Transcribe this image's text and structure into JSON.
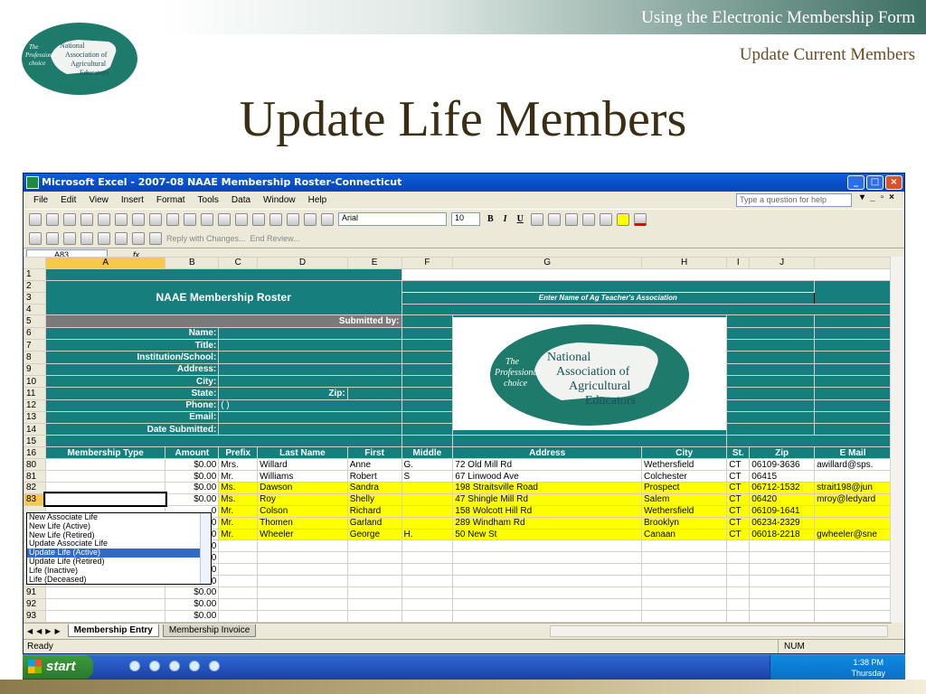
{
  "slide": {
    "header": "Using the Electronic Membership Form",
    "subheader": "Update Current Members",
    "title": "Update Life Members",
    "logo": {
      "line1": "The",
      "line2": "Professional",
      "line3": "choice",
      "n": "National",
      "a": "Association of",
      "g": "Agricultural",
      "e": "Educators"
    }
  },
  "excel": {
    "title": "Microsoft Excel - 2007-08 NAAE Membership Roster-Connecticut",
    "menu": [
      "File",
      "Edit",
      "View",
      "Insert",
      "Format",
      "Tools",
      "Data",
      "Window",
      "Help"
    ],
    "help_placeholder": "Type a question for help",
    "font_name": "Arial",
    "font_size": "10",
    "review_text": "Reply with Changes...",
    "end_review": "End Review...",
    "name_box": "A83",
    "fx": "fx",
    "columns": [
      "A",
      "B",
      "C",
      "D",
      "E",
      "F",
      "G",
      "H",
      "I",
      "J"
    ],
    "roster_title": "NAAE Membership Roster",
    "assoc_prompt": "Enter Name of Ag Teacher's Association",
    "submitted_by": "Submitted by:",
    "fields": [
      "Name:",
      "Title:",
      "Institution/School:",
      "Address:",
      "City:",
      "State:",
      "Phone:",
      "Email:",
      "Date Submitted:"
    ],
    "zip_label": "Zip:",
    "phone_value": "(      )",
    "headers": [
      "Membership Type",
      "Amount",
      "Prefix",
      "Last Name",
      "First",
      "Middle",
      "Address",
      "City",
      "St.",
      "Zip",
      "E Mail"
    ],
    "rows": [
      {
        "n": "80",
        "amt": "$0.00",
        "prefix": "Mrs.",
        "last": "Willard",
        "first": "Anne",
        "middle": "G.",
        "addr": "72 Old Mill Rd",
        "city": "Wethersfield",
        "st": "CT",
        "zip": "06109-3636",
        "email": "awillard@sps."
      },
      {
        "n": "81",
        "amt": "$0.00",
        "prefix": "Mr.",
        "last": "Williams",
        "first": "Robert",
        "middle": "S",
        "addr": "67 Linwood Ave",
        "city": "Colchester",
        "st": "CT",
        "zip": "06415",
        "email": ""
      },
      {
        "n": "82",
        "amt": "$0.00",
        "prefix": "Ms.",
        "last": "Dawson",
        "first": "Sandra",
        "middle": "",
        "addr": "198 Straitsville Road",
        "city": "Prospect",
        "st": "CT",
        "zip": "06712-1532",
        "email": "strait198@jun"
      },
      {
        "n": "83",
        "amt": "$0.00",
        "prefix": "Ms.",
        "last": "Roy",
        "first": "Shelly",
        "middle": "",
        "addr": "47 Shingle Mill Rd",
        "city": "Salem",
        "st": "CT",
        "zip": "06420",
        "email": "mroy@ledyard"
      },
      {
        "n": "",
        "amt": "0",
        "prefix": "Mr.",
        "last": "Colson",
        "first": "Richard",
        "middle": "",
        "addr": "158 Wolcott Hill Rd",
        "city": "Wethersfield",
        "st": "CT",
        "zip": "06109-1641",
        "email": ""
      },
      {
        "n": "",
        "amt": "0",
        "prefix": "Mr.",
        "last": "Thomen",
        "first": "Garland",
        "middle": "",
        "addr": "289 Windham Rd",
        "city": "Brooklyn",
        "st": "CT",
        "zip": "06234-2329",
        "email": ""
      },
      {
        "n": "",
        "amt": "0",
        "prefix": "Mr.",
        "last": "Wheeler",
        "first": "George",
        "middle": "H.",
        "addr": "50 New St",
        "city": "Canaan",
        "st": "CT",
        "zip": "06018-2218",
        "email": "gwheeler@sne"
      },
      {
        "n": "",
        "amt": "0",
        "prefix": "",
        "last": "",
        "first": "",
        "middle": "",
        "addr": "",
        "city": "",
        "st": "",
        "zip": "",
        "email": ""
      },
      {
        "n": "",
        "amt": "0",
        "prefix": "",
        "last": "",
        "first": "",
        "middle": "",
        "addr": "",
        "city": "",
        "st": "",
        "zip": "",
        "email": ""
      },
      {
        "n": "",
        "amt": "0",
        "prefix": "",
        "last": "",
        "first": "",
        "middle": "",
        "addr": "",
        "city": "",
        "st": "",
        "zip": "",
        "email": ""
      },
      {
        "n": "90",
        "amt": "$0.00",
        "prefix": "",
        "last": "",
        "first": "",
        "middle": "",
        "addr": "",
        "city": "",
        "st": "",
        "zip": "",
        "email": ""
      },
      {
        "n": "91",
        "amt": "$0.00",
        "prefix": "",
        "last": "",
        "first": "",
        "middle": "",
        "addr": "",
        "city": "",
        "st": "",
        "zip": "",
        "email": ""
      },
      {
        "n": "92",
        "amt": "$0.00",
        "prefix": "",
        "last": "",
        "first": "",
        "middle": "",
        "addr": "",
        "city": "",
        "st": "",
        "zip": "",
        "email": ""
      },
      {
        "n": "93",
        "amt": "$0.00",
        "prefix": "",
        "last": "",
        "first": "",
        "middle": "",
        "addr": "",
        "city": "",
        "st": "",
        "zip": "",
        "email": ""
      }
    ],
    "dropdown_options": [
      "New Associate Life",
      "New Life (Active)",
      "New Life (Retired)",
      "Update Associate Life",
      "Update Life (Active)",
      "Update Life (Retired)",
      "Life (Inactive)",
      "Life (Deceased)"
    ],
    "dropdown_selected": "Update Life (Active)",
    "sheet_tabs": [
      "Membership Entry",
      "Membership Invoice"
    ],
    "status": "Ready",
    "status_num": "NUM"
  },
  "taskbar": {
    "start": "start",
    "time": "1:38 PM",
    "day": "Thursday"
  },
  "colors": {
    "teal": "#177e7e",
    "highlight": "#ffff00",
    "accent_brown": "#6b4b22"
  }
}
